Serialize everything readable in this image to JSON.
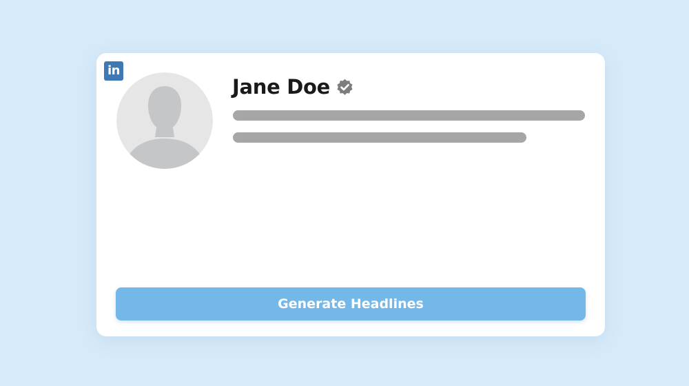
{
  "brand": {
    "logo_text": "in",
    "logo_icon": "linkedin-logo-icon",
    "color": "#3f78b3"
  },
  "profile": {
    "avatar_icon": "person-silhouette-icon",
    "name": "Jane Doe",
    "verified_icon": "verified-badge-icon"
  },
  "actions": {
    "generate_label": "Generate Headlines",
    "accent_color": "#74b8ea"
  }
}
